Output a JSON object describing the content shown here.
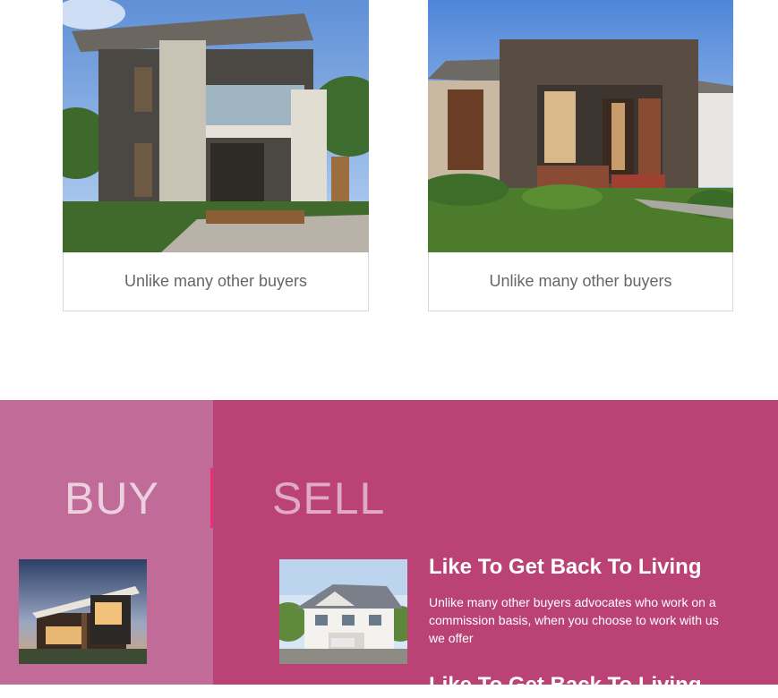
{
  "cards": [
    {
      "caption": "Unlike many other buyers",
      "image": "modern-two-storey-house-photo"
    },
    {
      "caption": "Unlike many other buyers",
      "image": "single-storey-brick-house-photo"
    }
  ],
  "buysell": {
    "buy_label": "BUY",
    "sell_label": "SELL",
    "buy_image": "modern-house-dusk-photo",
    "sell_image": "white-two-storey-villa-photo",
    "feature_title": "Like To Get Back To Living",
    "feature_text": "Unlike many other buyers advocates who work on a commission basis, when you choose to work with us we offer",
    "feature_title_2": "Like To Get Back To Living"
  },
  "colors": {
    "buy_panel": "#c16b98",
    "sell_panel": "#ba4275",
    "tab_active_accent": "#e8307a",
    "buy_text": "#ecd0e0",
    "sell_text": "#e0a9c6"
  }
}
